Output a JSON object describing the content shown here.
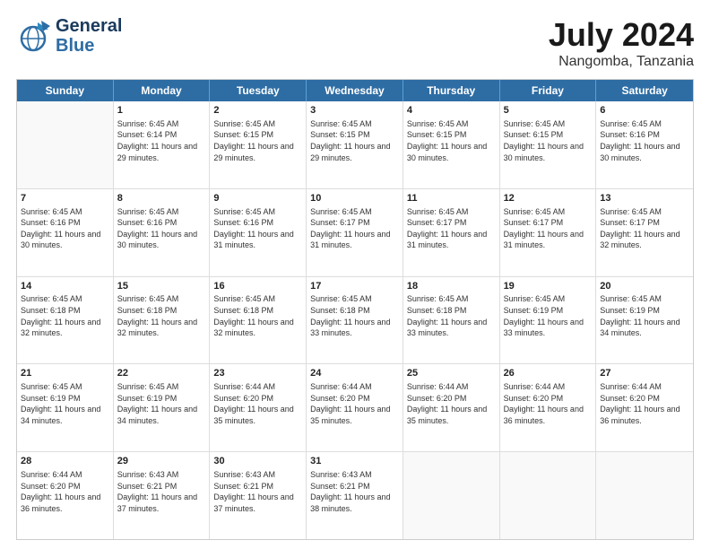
{
  "header": {
    "logo": {
      "line1": "General",
      "line2": "Blue"
    },
    "title": "July 2024",
    "subtitle": "Nangomba, Tanzania"
  },
  "days": [
    "Sunday",
    "Monday",
    "Tuesday",
    "Wednesday",
    "Thursday",
    "Friday",
    "Saturday"
  ],
  "rows": [
    [
      {
        "day": "",
        "sunrise": "",
        "sunset": "",
        "daylight": ""
      },
      {
        "day": "1",
        "sunrise": "Sunrise: 6:45 AM",
        "sunset": "Sunset: 6:14 PM",
        "daylight": "Daylight: 11 hours and 29 minutes."
      },
      {
        "day": "2",
        "sunrise": "Sunrise: 6:45 AM",
        "sunset": "Sunset: 6:15 PM",
        "daylight": "Daylight: 11 hours and 29 minutes."
      },
      {
        "day": "3",
        "sunrise": "Sunrise: 6:45 AM",
        "sunset": "Sunset: 6:15 PM",
        "daylight": "Daylight: 11 hours and 29 minutes."
      },
      {
        "day": "4",
        "sunrise": "Sunrise: 6:45 AM",
        "sunset": "Sunset: 6:15 PM",
        "daylight": "Daylight: 11 hours and 30 minutes."
      },
      {
        "day": "5",
        "sunrise": "Sunrise: 6:45 AM",
        "sunset": "Sunset: 6:15 PM",
        "daylight": "Daylight: 11 hours and 30 minutes."
      },
      {
        "day": "6",
        "sunrise": "Sunrise: 6:45 AM",
        "sunset": "Sunset: 6:16 PM",
        "daylight": "Daylight: 11 hours and 30 minutes."
      }
    ],
    [
      {
        "day": "7",
        "sunrise": "Sunrise: 6:45 AM",
        "sunset": "Sunset: 6:16 PM",
        "daylight": "Daylight: 11 hours and 30 minutes."
      },
      {
        "day": "8",
        "sunrise": "Sunrise: 6:45 AM",
        "sunset": "Sunset: 6:16 PM",
        "daylight": "Daylight: 11 hours and 30 minutes."
      },
      {
        "day": "9",
        "sunrise": "Sunrise: 6:45 AM",
        "sunset": "Sunset: 6:16 PM",
        "daylight": "Daylight: 11 hours and 31 minutes."
      },
      {
        "day": "10",
        "sunrise": "Sunrise: 6:45 AM",
        "sunset": "Sunset: 6:17 PM",
        "daylight": "Daylight: 11 hours and 31 minutes."
      },
      {
        "day": "11",
        "sunrise": "Sunrise: 6:45 AM",
        "sunset": "Sunset: 6:17 PM",
        "daylight": "Daylight: 11 hours and 31 minutes."
      },
      {
        "day": "12",
        "sunrise": "Sunrise: 6:45 AM",
        "sunset": "Sunset: 6:17 PM",
        "daylight": "Daylight: 11 hours and 31 minutes."
      },
      {
        "day": "13",
        "sunrise": "Sunrise: 6:45 AM",
        "sunset": "Sunset: 6:17 PM",
        "daylight": "Daylight: 11 hours and 32 minutes."
      }
    ],
    [
      {
        "day": "14",
        "sunrise": "Sunrise: 6:45 AM",
        "sunset": "Sunset: 6:18 PM",
        "daylight": "Daylight: 11 hours and 32 minutes."
      },
      {
        "day": "15",
        "sunrise": "Sunrise: 6:45 AM",
        "sunset": "Sunset: 6:18 PM",
        "daylight": "Daylight: 11 hours and 32 minutes."
      },
      {
        "day": "16",
        "sunrise": "Sunrise: 6:45 AM",
        "sunset": "Sunset: 6:18 PM",
        "daylight": "Daylight: 11 hours and 32 minutes."
      },
      {
        "day": "17",
        "sunrise": "Sunrise: 6:45 AM",
        "sunset": "Sunset: 6:18 PM",
        "daylight": "Daylight: 11 hours and 33 minutes."
      },
      {
        "day": "18",
        "sunrise": "Sunrise: 6:45 AM",
        "sunset": "Sunset: 6:18 PM",
        "daylight": "Daylight: 11 hours and 33 minutes."
      },
      {
        "day": "19",
        "sunrise": "Sunrise: 6:45 AM",
        "sunset": "Sunset: 6:19 PM",
        "daylight": "Daylight: 11 hours and 33 minutes."
      },
      {
        "day": "20",
        "sunrise": "Sunrise: 6:45 AM",
        "sunset": "Sunset: 6:19 PM",
        "daylight": "Daylight: 11 hours and 34 minutes."
      }
    ],
    [
      {
        "day": "21",
        "sunrise": "Sunrise: 6:45 AM",
        "sunset": "Sunset: 6:19 PM",
        "daylight": "Daylight: 11 hours and 34 minutes."
      },
      {
        "day": "22",
        "sunrise": "Sunrise: 6:45 AM",
        "sunset": "Sunset: 6:19 PM",
        "daylight": "Daylight: 11 hours and 34 minutes."
      },
      {
        "day": "23",
        "sunrise": "Sunrise: 6:44 AM",
        "sunset": "Sunset: 6:20 PM",
        "daylight": "Daylight: 11 hours and 35 minutes."
      },
      {
        "day": "24",
        "sunrise": "Sunrise: 6:44 AM",
        "sunset": "Sunset: 6:20 PM",
        "daylight": "Daylight: 11 hours and 35 minutes."
      },
      {
        "day": "25",
        "sunrise": "Sunrise: 6:44 AM",
        "sunset": "Sunset: 6:20 PM",
        "daylight": "Daylight: 11 hours and 35 minutes."
      },
      {
        "day": "26",
        "sunrise": "Sunrise: 6:44 AM",
        "sunset": "Sunset: 6:20 PM",
        "daylight": "Daylight: 11 hours and 36 minutes."
      },
      {
        "day": "27",
        "sunrise": "Sunrise: 6:44 AM",
        "sunset": "Sunset: 6:20 PM",
        "daylight": "Daylight: 11 hours and 36 minutes."
      }
    ],
    [
      {
        "day": "28",
        "sunrise": "Sunrise: 6:44 AM",
        "sunset": "Sunset: 6:20 PM",
        "daylight": "Daylight: 11 hours and 36 minutes."
      },
      {
        "day": "29",
        "sunrise": "Sunrise: 6:43 AM",
        "sunset": "Sunset: 6:21 PM",
        "daylight": "Daylight: 11 hours and 37 minutes."
      },
      {
        "day": "30",
        "sunrise": "Sunrise: 6:43 AM",
        "sunset": "Sunset: 6:21 PM",
        "daylight": "Daylight: 11 hours and 37 minutes."
      },
      {
        "day": "31",
        "sunrise": "Sunrise: 6:43 AM",
        "sunset": "Sunset: 6:21 PM",
        "daylight": "Daylight: 11 hours and 38 minutes."
      },
      {
        "day": "",
        "sunrise": "",
        "sunset": "",
        "daylight": ""
      },
      {
        "day": "",
        "sunrise": "",
        "sunset": "",
        "daylight": ""
      },
      {
        "day": "",
        "sunrise": "",
        "sunset": "",
        "daylight": ""
      }
    ]
  ]
}
